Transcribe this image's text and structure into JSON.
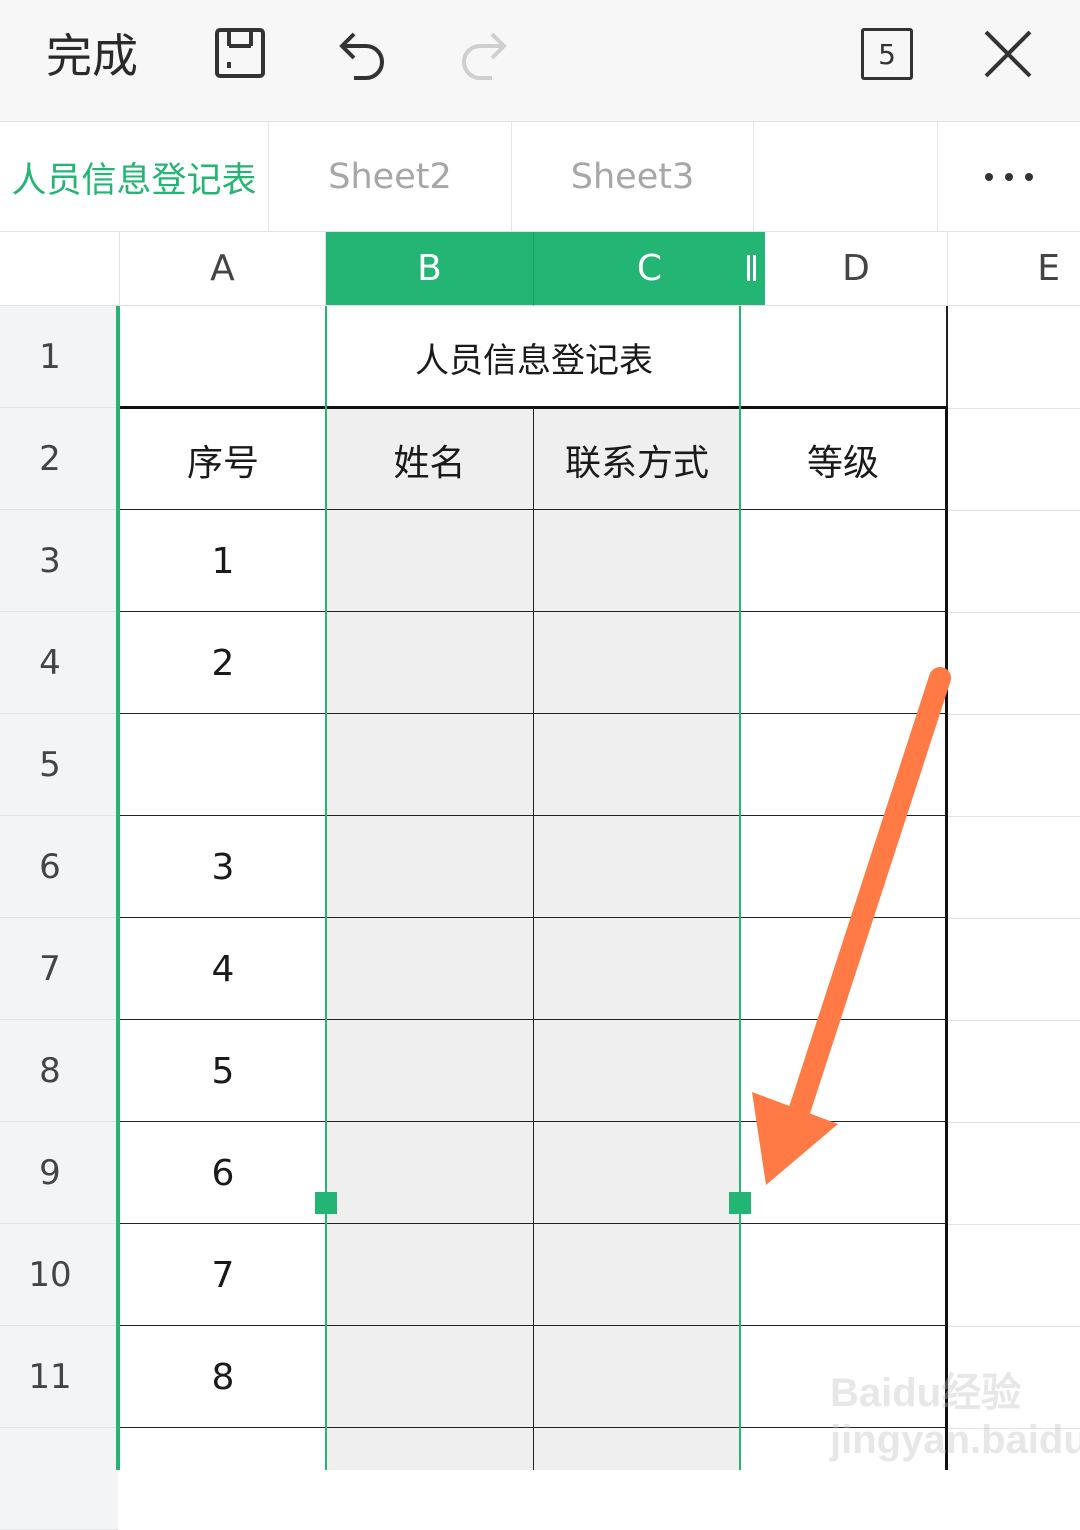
{
  "toolbar": {
    "done_label": "完成",
    "sheet_count": "5",
    "icons": [
      "save-icon",
      "undo-icon",
      "redo-icon",
      "sheet-count-icon",
      "close-icon"
    ]
  },
  "tabs": {
    "items": [
      {
        "label": "人员信息登记表",
        "active": true
      },
      {
        "label": "Sheet2",
        "active": false
      },
      {
        "label": "Sheet3",
        "active": false
      }
    ],
    "more_icon": "more-icon"
  },
  "columns": [
    "A",
    "B",
    "C",
    "D",
    "E"
  ],
  "selected_columns": [
    "B",
    "C"
  ],
  "rows": [
    "1",
    "2",
    "3",
    "4",
    "5",
    "6",
    "7",
    "8",
    "9",
    "10",
    "11"
  ],
  "sheet": {
    "title": "人员信息登记表",
    "headers": [
      "序号",
      "姓名",
      "联系方式",
      "等级"
    ],
    "serials": [
      "1",
      "2",
      "",
      "3",
      "4",
      "5",
      "6",
      "7",
      "8"
    ]
  },
  "colors": {
    "accent": "#22b573",
    "selection_fill": "#efefef",
    "arrow": "#ff7a45"
  },
  "watermark": "Baidu经验 jingyan.baidu.com"
}
